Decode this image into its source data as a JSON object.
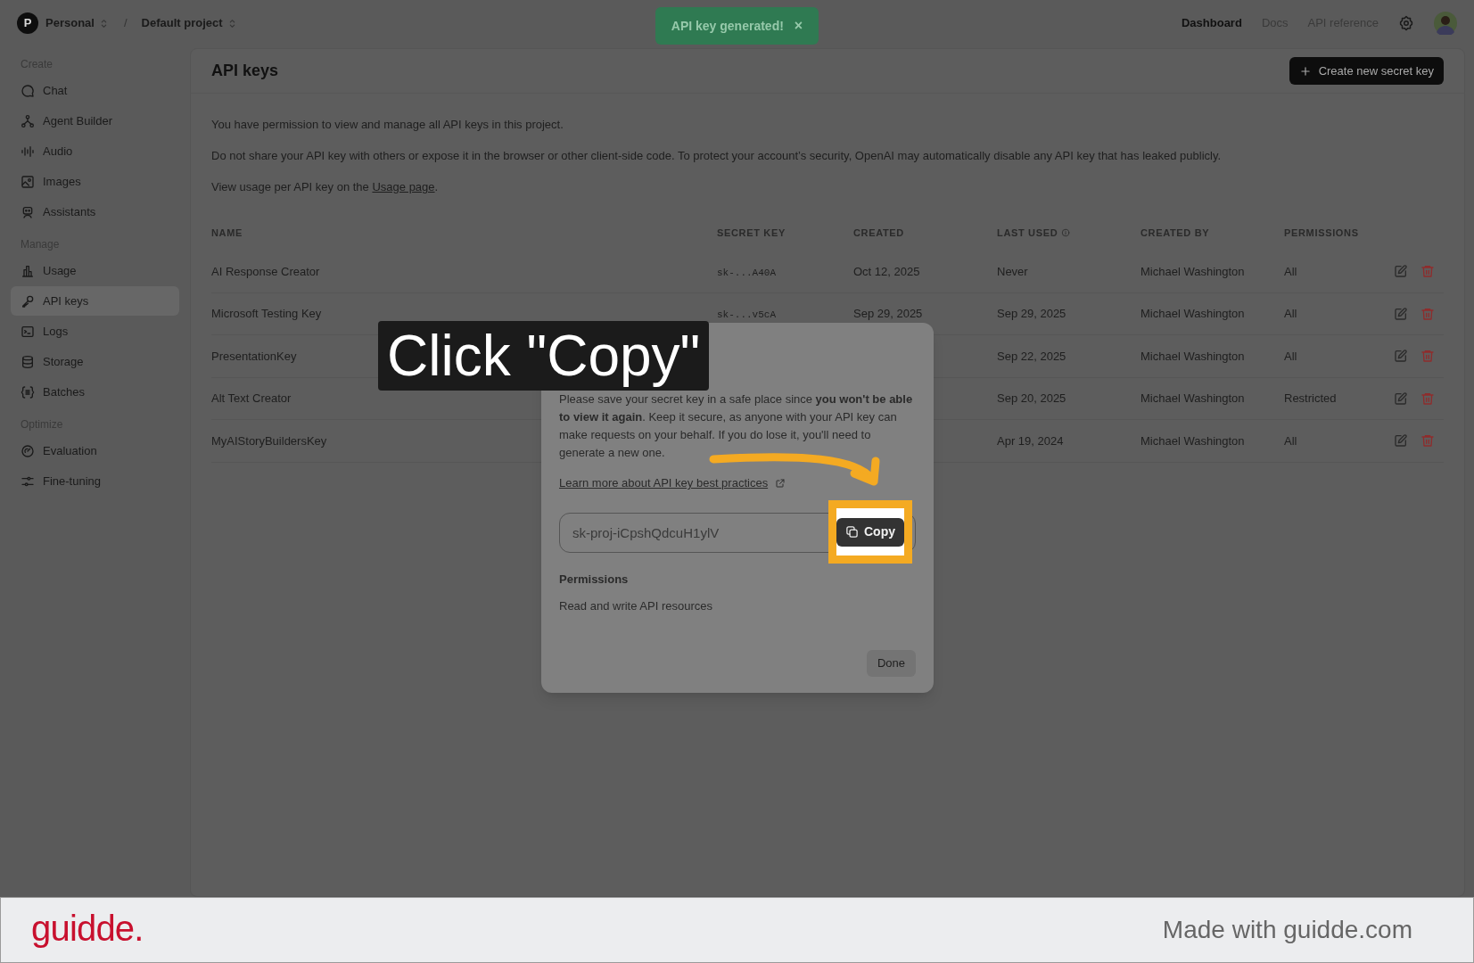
{
  "top_bar": {
    "avatar_letter": "P",
    "org": "Personal",
    "separator": "/",
    "project": "Default project",
    "nav": [
      {
        "label": "Dashboard",
        "selected": true
      },
      {
        "label": "Docs",
        "selected": false
      },
      {
        "label": "API reference",
        "selected": false
      }
    ]
  },
  "toast": {
    "text": "API key generated!",
    "close": "×"
  },
  "sidebar": {
    "sections": [
      {
        "title": "Create",
        "items": [
          {
            "label": "Chat",
            "selected": false
          },
          {
            "label": "Agent Builder",
            "selected": false
          },
          {
            "label": "Audio",
            "selected": false
          },
          {
            "label": "Images",
            "selected": false
          },
          {
            "label": "Assistants",
            "selected": false
          }
        ]
      },
      {
        "title": "Manage",
        "items": [
          {
            "label": "Usage",
            "selected": false
          },
          {
            "label": "API keys",
            "selected": true
          },
          {
            "label": "Logs",
            "selected": false
          },
          {
            "label": "Storage",
            "selected": false
          },
          {
            "label": "Batches",
            "selected": false
          }
        ]
      },
      {
        "title": "Optimize",
        "items": [
          {
            "label": "Evaluation",
            "selected": false
          },
          {
            "label": "Fine-tuning",
            "selected": false
          }
        ]
      }
    ]
  },
  "page": {
    "title": "API keys",
    "create_button": "Create new secret key",
    "intro": "You have permission to view and manage all API keys in this project.",
    "notice": "Do not share your API key with others or expose it in the browser or other client-side code. To protect your account’s security, OpenAI may automatically disable any API key that has leaked publicly.",
    "usage_before": "View usage per API key on the ",
    "usage_link": "Usage page",
    "usage_after": "."
  },
  "table": {
    "columns": [
      "NAME",
      "SECRET KEY",
      "CREATED",
      "LAST USED",
      "CREATED BY",
      "PERMISSIONS"
    ],
    "rows": [
      {
        "name": "AI Response Creator",
        "secret_key": "sk-...A40A",
        "created": "Oct 12, 2025",
        "last_used": "Never",
        "created_by": "Michael Washington",
        "permissions": "All"
      },
      {
        "name": "Microsoft Testing Key",
        "secret_key": "sk-...v5cA",
        "created": "Sep 29, 2025",
        "last_used": "Sep 29, 2025",
        "created_by": "Michael Washington",
        "permissions": "All"
      },
      {
        "name": "PresentationKey",
        "last_used": "Sep 22, 2025",
        "created_by": "Michael Washington",
        "permissions": "All"
      },
      {
        "name": "Alt Text Creator",
        "last_used": "Sep 20, 2025",
        "created_by": "Michael Washington",
        "permissions": "Restricted"
      },
      {
        "name": "MyAIStoryBuildersKey",
        "last_used": "Apr 19, 2024",
        "created_by": "Michael Washington",
        "permissions": "All"
      }
    ]
  },
  "modal": {
    "body": "Please save your secret key in a safe place since **you won't be able to view it again**. Keep it secure, as anyone with your API key can make requests on your behalf. If you do lose it, you'll need to generate a new one.",
    "link": "Learn more about API key best practices",
    "key_value": "sk-proj-iCpshQdcuH1ylV",
    "copy_button": "Copy",
    "permissions_label": "Permissions",
    "permissions_value": "Read and write API resources",
    "done_button": "Done"
  },
  "callout": {
    "text": "Click \"Copy\""
  },
  "footer": {
    "logo": "guidde.",
    "tagline": "Made with guidde.com"
  }
}
